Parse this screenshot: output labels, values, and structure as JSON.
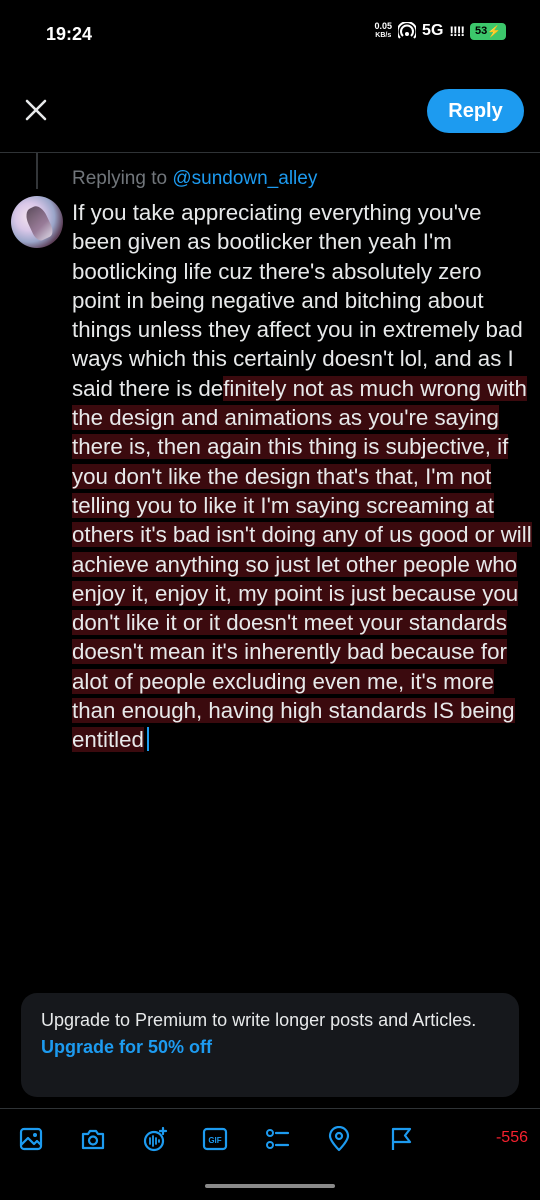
{
  "status_bar": {
    "time": "19:24",
    "speed_value": "0.05",
    "speed_unit": "KB/s",
    "network": "5G",
    "signal": "!!!!",
    "battery": "53"
  },
  "header": {
    "close_icon": "close-icon",
    "reply_label": "Reply"
  },
  "reply_context": {
    "prefix": "Replying to ",
    "handle": "@sundown_alley"
  },
  "compose": {
    "text_within_limit": "If you take appreciating everything you've been given as bootlicker then yeah I'm bootlicking life cuz there's absolutely zero point in being negative and bitching about things unless they affect you in extremely bad ways which this certainly doesn't lol, and as I said there is de",
    "text_over_limit": "finitely not as much wrong with the design and animations as you're saying there is, then again this thing is subjective, if you don't like the design that's that, I'm not telling you to like it I'm saying screaming at others it's bad isn't doing any of us good or will achieve anything so just let other people who enjoy it, enjoy it, my point is just because you don't like it or it doesn't meet your standards doesn't mean it's inherently bad because for alot of people excluding even me, it's more than enough, having high standards IS being entitled"
  },
  "upsell": {
    "text": "Upgrade to Premium to write longer posts and Articles.",
    "link": "Upgrade for 50% off"
  },
  "toolbar": {
    "icons": [
      "image-icon",
      "camera-icon",
      "grok-icon",
      "gif-icon",
      "poll-icon",
      "location-icon",
      "flag-icon"
    ],
    "gif_label": "GIF",
    "char_count": "-556"
  },
  "colors": {
    "accent": "#1d9bf0",
    "over_limit_bg": "#3b0a0e",
    "counter": "#f4212e"
  }
}
